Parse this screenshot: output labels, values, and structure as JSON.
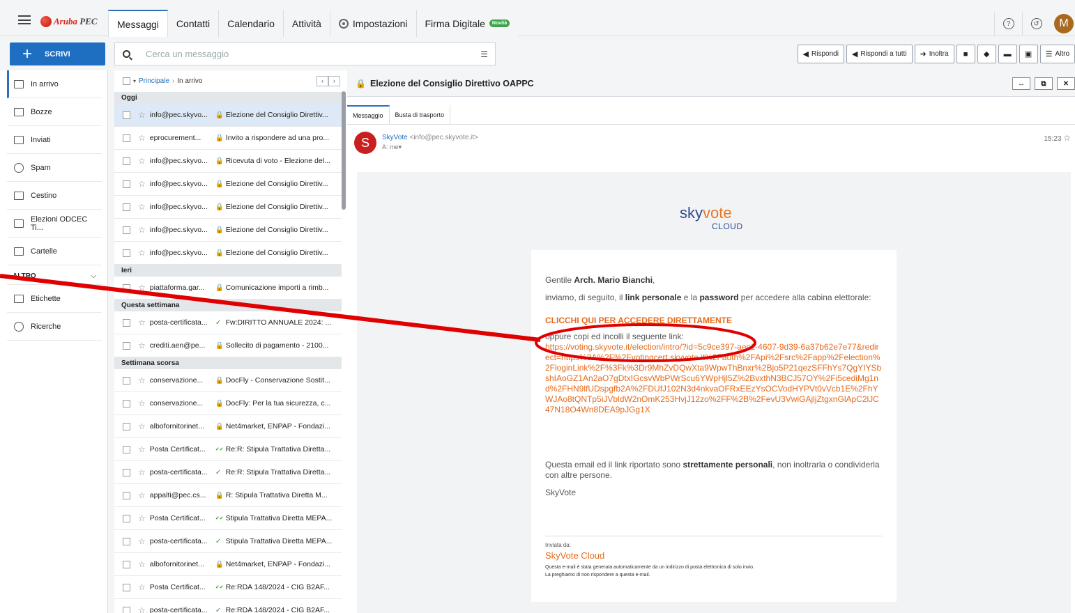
{
  "app": {
    "logo_brand": "Aruba",
    "logo_suffix": " PEC"
  },
  "nav": {
    "tabs": [
      {
        "label": "Messaggi"
      },
      {
        "label": "Contatti"
      },
      {
        "label": "Calendario"
      },
      {
        "label": "Attività"
      },
      {
        "label": "Impostazioni"
      },
      {
        "label": "Firma Digitale"
      }
    ],
    "new_badge": "Novità",
    "help_icon": "?",
    "user_initial": "M"
  },
  "toolbar": {
    "compose_label": "SCRIVI",
    "search_placeholder": "Cerca un messaggio",
    "reply": "Rispondi",
    "reply_all": "Rispondi a tutti",
    "forward": "Inoltra",
    "more": "Altro"
  },
  "sidebar": {
    "items": [
      {
        "label": "In arrivo"
      },
      {
        "label": "Bozze"
      },
      {
        "label": "Inviati"
      },
      {
        "label": "Spam"
      },
      {
        "label": "Cestino"
      },
      {
        "label": "Elezioni ODCEC Ti..."
      },
      {
        "label": "Cartelle"
      }
    ],
    "section_other": "ALTRO",
    "extra": [
      {
        "label": "Etichette"
      },
      {
        "label": "Ricerche"
      }
    ]
  },
  "list": {
    "breadcrumb_root": "Principale",
    "breadcrumb_current": "In arrivo",
    "groups": [
      {
        "title": "Oggi",
        "messages": [
          {
            "from": "info@pec.skyvo...",
            "subject": "Elezione del Consiglio Direttiv...",
            "mark": "lock",
            "selected": true
          },
          {
            "from": "eprocurement...",
            "subject": "Invito a rispondere ad una pro...",
            "mark": "lock"
          },
          {
            "from": "info@pec.skyvo...",
            "subject": "Ricevuta di voto - Elezione del...",
            "mark": "lock"
          },
          {
            "from": "info@pec.skyvo...",
            "subject": "Elezione del Consiglio Direttiv...",
            "mark": "lock"
          },
          {
            "from": "info@pec.skyvo...",
            "subject": "Elezione del Consiglio Direttiv...",
            "mark": "lock"
          },
          {
            "from": "info@pec.skyvo...",
            "subject": "Elezione del Consiglio Direttiv...",
            "mark": "lock"
          },
          {
            "from": "info@pec.skyvo...",
            "subject": "Elezione del Consiglio Direttiv...",
            "mark": "lock"
          }
        ]
      },
      {
        "title": "Ieri",
        "messages": [
          {
            "from": "piattaforma.gar...",
            "subject": "Comunicazione importi a rimb...",
            "mark": "lock"
          }
        ]
      },
      {
        "title": "Questa settimana",
        "messages": [
          {
            "from": "posta-certificata...",
            "subject": "Fw:DIRITTO ANNUALE 2024: ...",
            "mark": "check"
          },
          {
            "from": "crediti.aen@pe...",
            "subject": "Sollecito di pagamento - 2100...",
            "mark": "lock"
          }
        ]
      },
      {
        "title": "Settimana scorsa",
        "messages": [
          {
            "from": "conservazione...",
            "subject": "DocFly - Conservazione Sostit...",
            "mark": "lock"
          },
          {
            "from": "conservazione...",
            "subject": "DocFly: Per la tua sicurezza, c...",
            "mark": "lock"
          },
          {
            "from": "albofornitorinet...",
            "subject": "Net4market, ENPAP - Fondazi...",
            "mark": "lock"
          },
          {
            "from": "Posta Certificat...",
            "subject": "Re:R: Stipula Trattativa Diretta...",
            "mark": "dcheck"
          },
          {
            "from": "posta-certificata...",
            "subject": "Re:R: Stipula Trattativa Diretta...",
            "mark": "check"
          },
          {
            "from": "appalti@pec.cs...",
            "subject": "R: Stipula Trattativa Diretta M...",
            "mark": "lock"
          },
          {
            "from": "Posta Certificat...",
            "subject": "Stipula Trattativa Diretta MEPA...",
            "mark": "dcheck"
          },
          {
            "from": "posta-certificata...",
            "subject": "Stipula Trattativa Diretta MEPA...",
            "mark": "check"
          },
          {
            "from": "albofornitorinet...",
            "subject": "Net4market, ENPAP - Fondazi...",
            "mark": "lock"
          },
          {
            "from": "Posta Certificat...",
            "subject": "Re:RDA 148/2024 - CIG B2AF...",
            "mark": "dcheck"
          },
          {
            "from": "posta-certificata...",
            "subject": "Re:RDA 148/2024 - CIG B2AF...",
            "mark": "check"
          }
        ]
      }
    ]
  },
  "message": {
    "title": "Elezione del Consiglio Direttivo OAPPC",
    "tab_message": "Messaggio",
    "tab_envelope": "Busta di trasporto",
    "sender_initial": "S",
    "sender_name": "SkyVote",
    "sender_addr": "<info@pec.skyvote.it>",
    "to": "A: me",
    "time": "15:23",
    "logo_sky": "sky",
    "logo_vote": "vote",
    "logo_cloud": "CLOUD",
    "greeting_pre": "Gentile ",
    "greeting_name": "Arch.  Mario Bianchi",
    "greeting_post": ",",
    "intro_pre": "inviamo, di seguito, il ",
    "intro_link": "link personale",
    "intro_mid": " e la ",
    "intro_pw": "password",
    "intro_post": " per accedere alla cabina elettorale:",
    "cta": "CLICCHI QUI PER ACCEDERE DIRETTAMENTE",
    "copy_text": "oppure copi ed incolli il seguente link:",
    "url": "https://voting.skyvote.it/election/intro/?id=5c9ce397-aec1-4607-9d39-6a37b62e7e77&redirect=https%3A%2F%2Fvotingcert.skyvote.it%2Fauth%2FApi%2Fsrc%2Fapp%2Felection%2FloginLink%2F%3Fk%3Dr9MhZvDQwXta9WpwThBnxr%2Bjo5P21qezSFFhYs7QgYIYSbshIAoGZ1An2aO7gDtxIGcsvWbPWrScu6YWpHjl5Z%2BvxthN3BCJ57OY%2Fi5cediMg1nd%2FHN9lfUDspgfb2A%2FDUfJ102N3d4nkvaOFRxEEzYsOCVodHYPVt0vVcb1E%2FhYWJAo8tQNTp5iJVbldW2nOmK253HvjJ12zo%2FF%2B%2FevU3VwiGAjljZtgxnGlApC2lJC47N18O4Wn8DEA9pJGg1X",
    "personal_pre": "Questa email ed il link riportato sono ",
    "personal_bold": "strettamente personali",
    "personal_post": ", non inoltrarla o condividerla con altre persone.",
    "signature": "SkyVote",
    "sent_by": "Inviata da:",
    "sent_by_name": "SkyVote Cloud",
    "disclaimer_1": "Questa e-mail è stata generata automaticamente da un indirizzo di posta elettronica di solo invio.",
    "disclaimer_2": "La preghiamo di non rispondere a questa e-mail."
  },
  "colors": {
    "accent": "#1e6ec1",
    "annotation": "#e00000",
    "cta": "#e86a1a"
  }
}
